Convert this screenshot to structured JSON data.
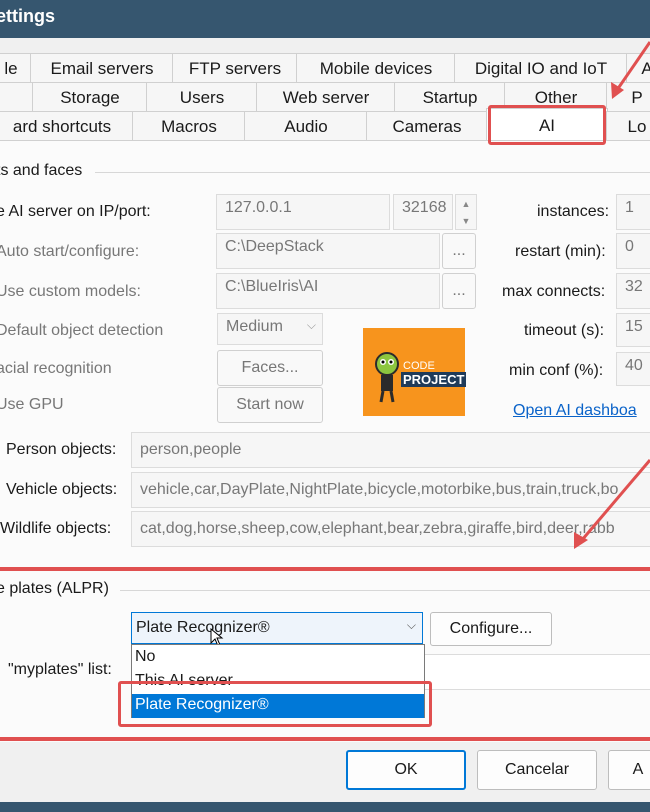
{
  "window": {
    "title": "ettings"
  },
  "tabs": {
    "row1": [
      "le",
      "Email servers",
      "FTP servers",
      "Mobile devices",
      "Digital IO and IoT",
      "A"
    ],
    "row2": [
      "Storage",
      "Users",
      "Web server",
      "Startup",
      "Other",
      "P"
    ],
    "row3": [
      "ard shortcuts",
      "Macros",
      "Audio",
      "Cameras",
      "AI",
      "Lo"
    ]
  },
  "objects_group": {
    "title": "ts and faces",
    "server_label": "e AI server on IP/port:",
    "ip": "127.0.0.1",
    "port": "32168",
    "instances_label": "instances:",
    "instances_value": "1",
    "autostart_label": "Auto start/configure:",
    "autostart_path": "C:\\DeepStack",
    "browse1": "...",
    "restart_label": "restart (min):",
    "restart_value": "0",
    "custom_models_label": "Use custom models:",
    "custom_models_path": "C:\\BlueIris\\AI",
    "browse2": "...",
    "maxconn_label": "max connects:",
    "maxconn_value": "32",
    "default_detect_label": "Default object detection",
    "default_detect_value": "Medium",
    "timeout_label": "timeout (s):",
    "timeout_value": "15",
    "facial_label": "acial recognition",
    "faces_button": "Faces...",
    "minconf_label": "min conf (%):",
    "minconf_value": "40",
    "gpu_label": "Use GPU",
    "startnow_button": "Start now",
    "dashboard_link": "Open AI dashboa",
    "logo_line1": "CODE",
    "logo_line2": "PROJECT",
    "person_label": "Person objects:",
    "person_value": "person,people",
    "vehicle_label": "Vehicle objects:",
    "vehicle_value": "vehicle,car,DayPlate,NightPlate,bicycle,motorbike,bus,train,truck,bo",
    "wildlife_label": "Wildlife objects:",
    "wildlife_value": "cat,dog,horse,sheep,cow,elephant,bear,zebra,giraffe,bird,deer,rabb"
  },
  "alpr_group": {
    "title": "e plates (ALPR)",
    "selected": "Plate Recognizer®",
    "configure_button": "Configure...",
    "myplates_label": "\"myplates\" list:",
    "options": [
      "No",
      "This AI server",
      "Plate Recognizer®"
    ]
  },
  "footer": {
    "ok": "OK",
    "cancel": "Cancelar",
    "apply": "A"
  },
  "colors": {
    "highlight": "#e05050",
    "selection": "#0078d7",
    "titlebar": "#36566f"
  }
}
